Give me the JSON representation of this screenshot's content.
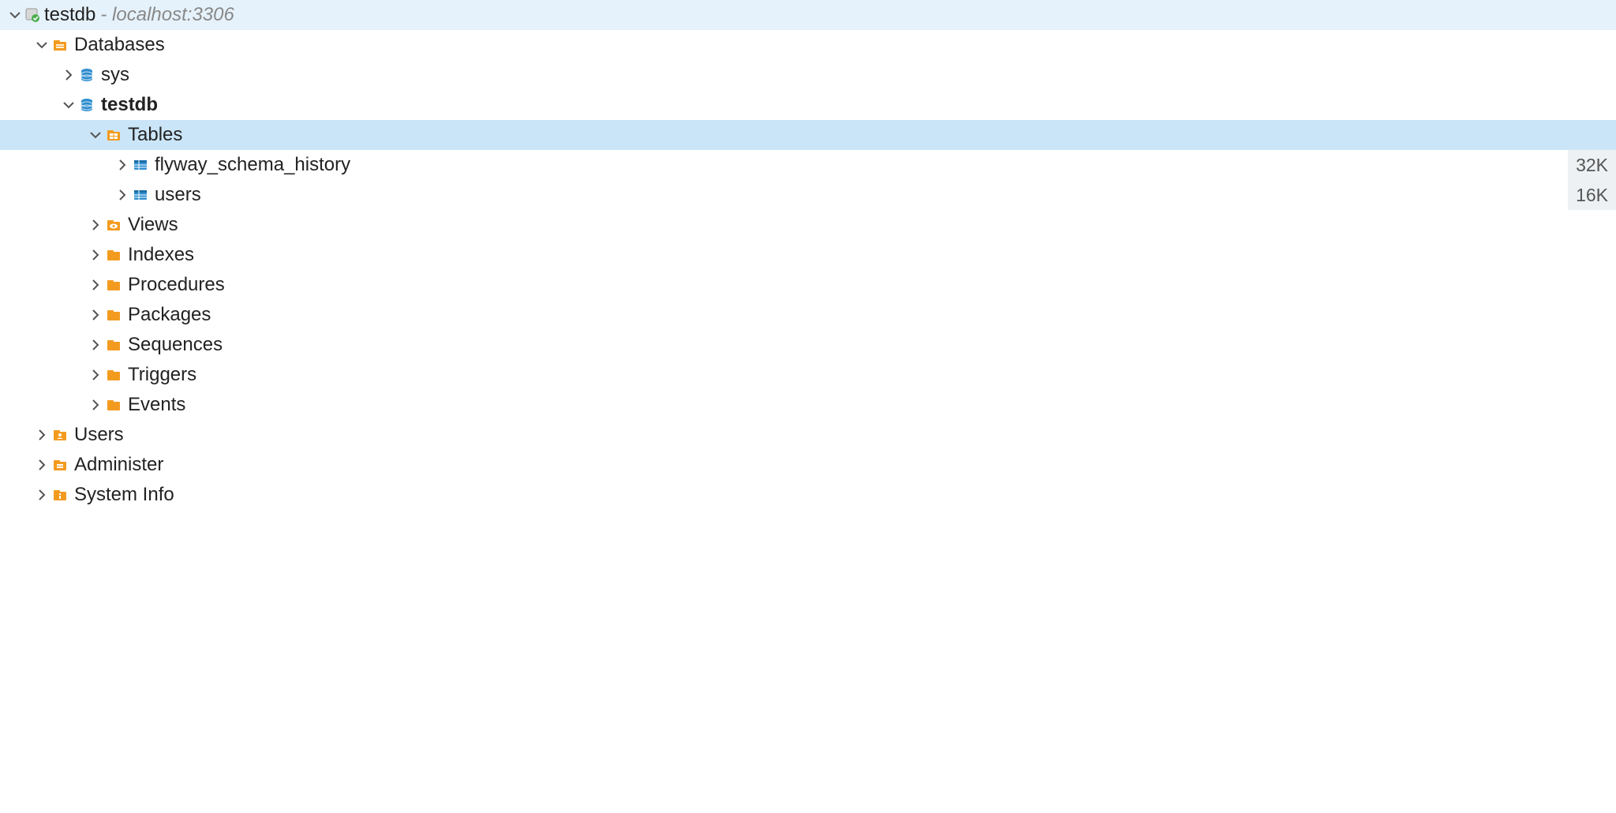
{
  "connection": {
    "name": "testdb",
    "host": "- localhost:3306"
  },
  "tree": {
    "databases_label": "Databases",
    "sys_label": "sys",
    "testdb_label": "testdb",
    "tables_label": "Tables",
    "tables": [
      {
        "name": "flyway_schema_history",
        "size": "32K"
      },
      {
        "name": "users",
        "size": "16K"
      }
    ],
    "views_label": "Views",
    "indexes_label": "Indexes",
    "procedures_label": "Procedures",
    "packages_label": "Packages",
    "sequences_label": "Sequences",
    "triggers_label": "Triggers",
    "events_label": "Events",
    "users_label": "Users",
    "administer_label": "Administer",
    "system_info_label": "System Info"
  },
  "colors": {
    "folder": "#f39b1f",
    "db": "#2e8ecf",
    "table": "#2e8ecf"
  }
}
